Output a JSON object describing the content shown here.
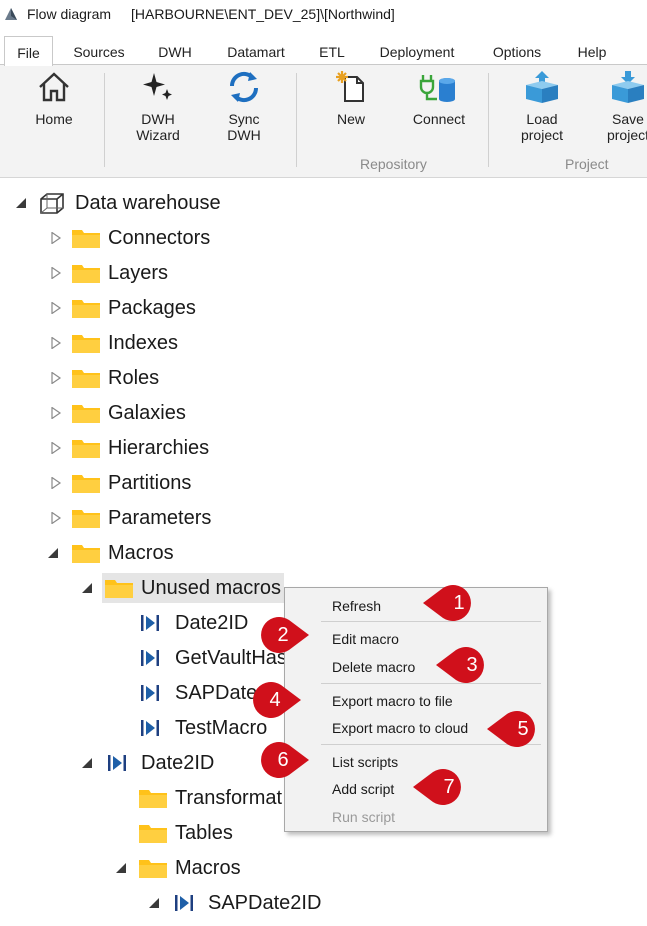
{
  "titlebar": {
    "title": "Flow diagram",
    "db": "[HARBOURNE\\ENT_DEV_25]\\[Northwind]"
  },
  "tabs": [
    "File",
    "Sources",
    "DWH",
    "Datamart",
    "ETL",
    "Deployment",
    "Options",
    "Help"
  ],
  "ribbon": {
    "home": "Home",
    "dwh_wizard": [
      "DWH",
      "Wizard"
    ],
    "sync_dwh": [
      "Sync",
      "DWH"
    ],
    "new": "New",
    "connect": "Connect",
    "load_project": [
      "Load",
      "project"
    ],
    "save_project": [
      "Save",
      "project"
    ],
    "group_repository": "Repository",
    "group_project": "Project"
  },
  "tree": {
    "root": "Data warehouse",
    "folders": [
      "Connectors",
      "Layers",
      "Packages",
      "Indexes",
      "Roles",
      "Galaxies",
      "Hierarchies",
      "Partitions",
      "Parameters",
      "Macros"
    ],
    "unused_macros": "Unused macros",
    "unused_items": [
      "Date2ID",
      "GetVaultHas",
      "SAPDate",
      "TestMacro"
    ],
    "date2id": "Date2ID",
    "date2id_children": [
      "Transformat",
      "Tables",
      "Macros"
    ],
    "sub_macro": "SAPDate2ID"
  },
  "context_menu": {
    "refresh": "Refresh",
    "edit_macro": "Edit macro",
    "delete_macro": "Delete macro",
    "export_file": "Export macro to file",
    "export_cloud": "Export macro to cloud",
    "list_scripts": "List scripts",
    "add_script": "Add script",
    "run_script": "Run script"
  },
  "callouts": [
    "1",
    "2",
    "3",
    "4",
    "5",
    "6",
    "7"
  ],
  "colors": {
    "callout_red": "#d0101b",
    "folder_yellow": "#ffc21a",
    "icon_blue": "#1e5fa8",
    "ribbon_bg": "#f3f3f3"
  }
}
